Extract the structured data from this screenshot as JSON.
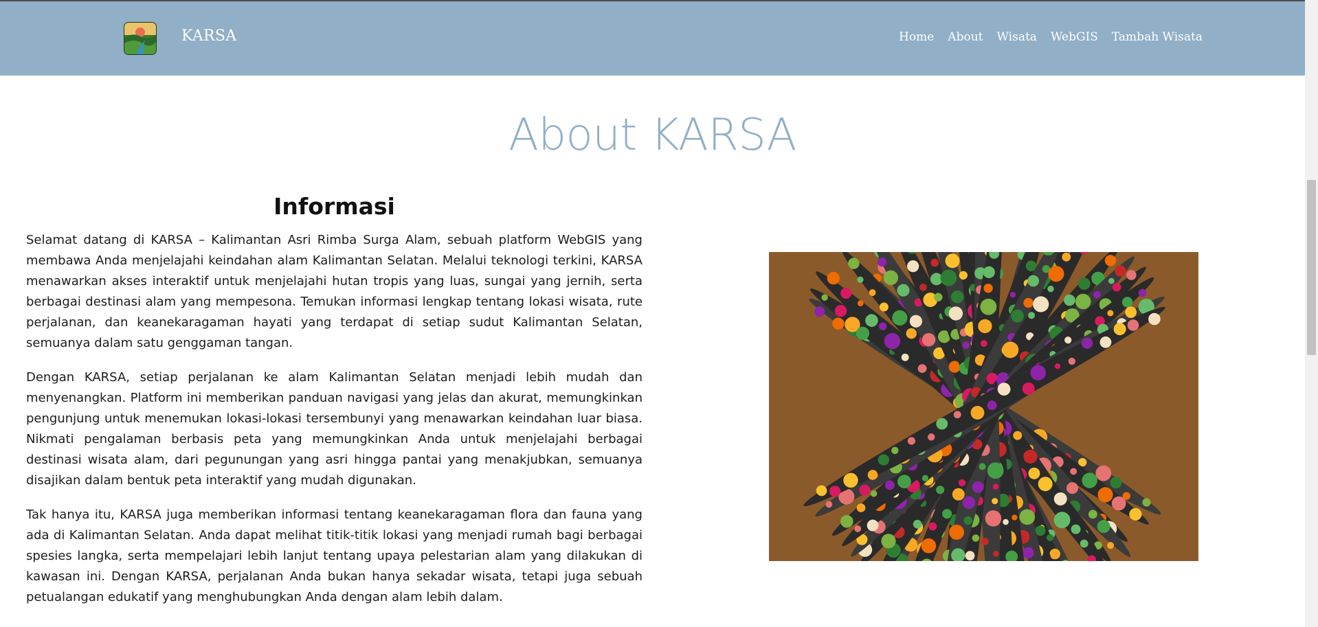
{
  "brand": "KARSA",
  "nav": [
    "Home",
    "About",
    "Wisata",
    "WebGIS",
    "Tambah Wisata"
  ],
  "page_title": "About KARSA",
  "info": {
    "title": "Informasi",
    "paragraphs": [
      "Selamat datang di KARSA – Kalimantan Asri Rimba Surga Alam, sebuah platform WebGIS yang membawa Anda menjelajahi keindahan alam Kalimantan Selatan. Melalui teknologi terkini, KARSA menawarkan akses interaktif untuk menjelajahi hutan tropis yang luas, sungai yang jernih, serta berbagai destinasi alam yang mempesona. Temukan informasi lengkap tentang lokasi wisata, rute perjalanan, dan keanekaragaman hayati yang terdapat di setiap sudut Kalimantan Selatan, semuanya dalam satu genggaman tangan.",
      "Dengan KARSA, setiap perjalanan ke alam Kalimantan Selatan menjadi lebih mudah dan menyenangkan. Platform ini memberikan panduan navigasi yang jelas dan akurat, memungkinkan pengunjung untuk menemukan lokasi-lokasi tersembunyi yang menawarkan keindahan luar biasa. Nikmati pengalaman berbasis peta yang memungkinkan Anda untuk menjelajahi berbagai destinasi wisata alam, dari pegunungan yang asri hingga pantai yang menakjubkan, semuanya disajikan dalam bentuk peta interaktif yang mudah digunakan.",
      "Tak hanya itu, KARSA juga memberikan informasi tentang keanekaragaman flora dan fauna yang ada di Kalimantan Selatan. Anda dapat melihat titik-titik lokasi yang menjadi rumah bagi berbagai spesies langka, serta mempelajari lebih lanjut tentang upaya pelestarian alam yang dilakukan di kawasan ini. Dengan KARSA, perjalanan Anda bukan hanya sekadar wisata, tetapi juga sebuah petualangan edukatif yang menghubungkan Anda dengan alam lebih dalam."
    ]
  },
  "colors": {
    "navbar": "#91afc7",
    "title": "#91afc7"
  }
}
